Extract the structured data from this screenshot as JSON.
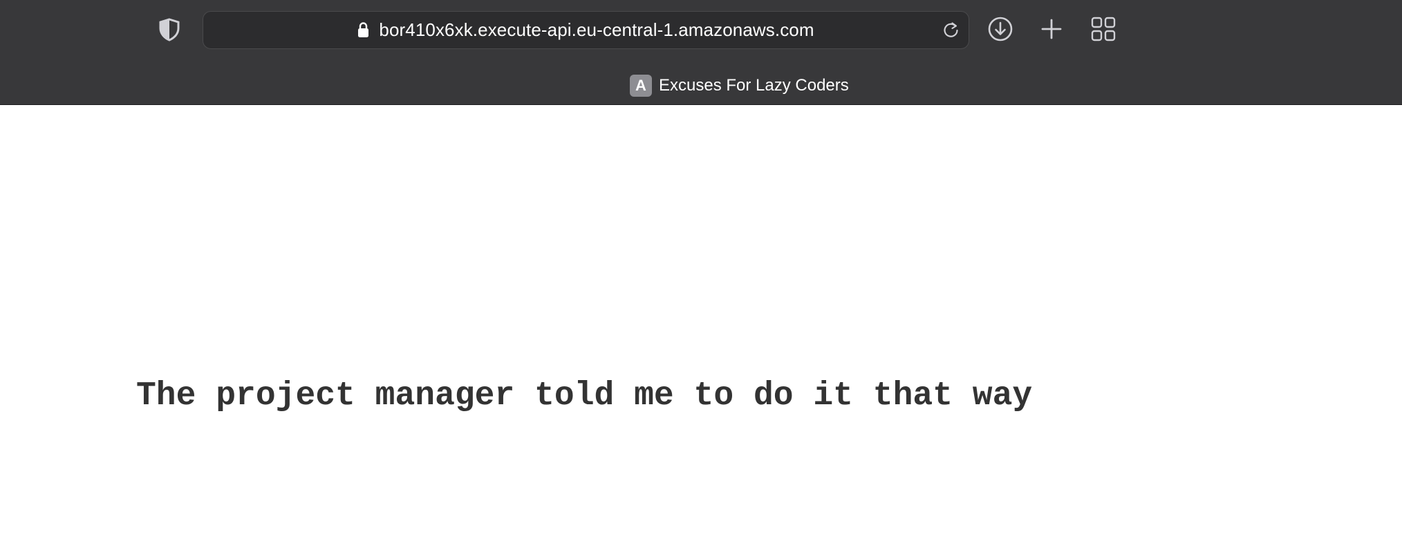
{
  "browser": {
    "url": "bor410x6xk.execute-api.eu-central-1.amazonaws.com",
    "tab": {
      "favicon_letter": "A",
      "title": "Excuses For Lazy Coders"
    },
    "icons": {
      "privacy": "shield-icon",
      "secure": "lock-icon",
      "reload": "reload-icon",
      "download": "download-icon",
      "new_tab": "plus-icon",
      "tab_overview": "grid-icon"
    },
    "colors": {
      "chrome_background": "#38383a",
      "address_background": "#2c2c2e",
      "favicon_background": "#8e8e93"
    }
  },
  "page": {
    "excuse": "The project manager told me to do it that way",
    "text_color": "#333333",
    "background": "#ffffff"
  }
}
